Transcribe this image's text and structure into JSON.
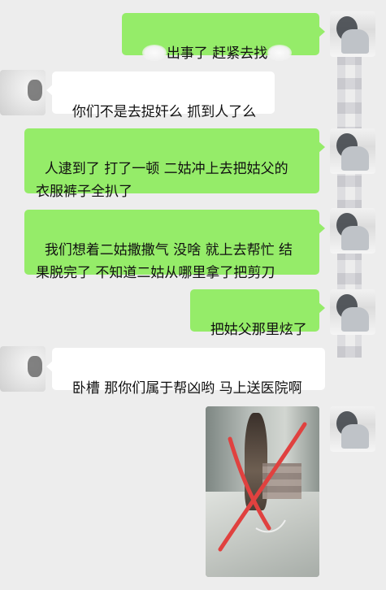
{
  "messages": [
    {
      "side": "right",
      "text_visible": "出事了 赶紧去找"
    },
    {
      "side": "left",
      "text": "你们不是去捉奸么 抓到人了么"
    },
    {
      "side": "right",
      "text": "人逮到了 打了一顿 二姑冲上去把姑父的\n衣服裤子全扒了"
    },
    {
      "side": "right",
      "text": "我们想着二姑撒撒气 没啥 就上去帮忙 结\n果脱完了 不知道二姑从哪里拿了把剪刀"
    },
    {
      "side": "right",
      "text": "把姑父那里炫了"
    },
    {
      "side": "left",
      "text": "卧槽 那你们属于帮凶哟 马上送医院啊"
    },
    {
      "side": "right",
      "type": "image"
    }
  ],
  "colors": {
    "background": "#ededed",
    "sent_bubble": "#95ec69",
    "received_bubble": "#ffffff",
    "annotation_line": "#e0413f"
  },
  "icons": {
    "right_avatar": "user-avatar",
    "left_avatar": "contact-avatar"
  }
}
